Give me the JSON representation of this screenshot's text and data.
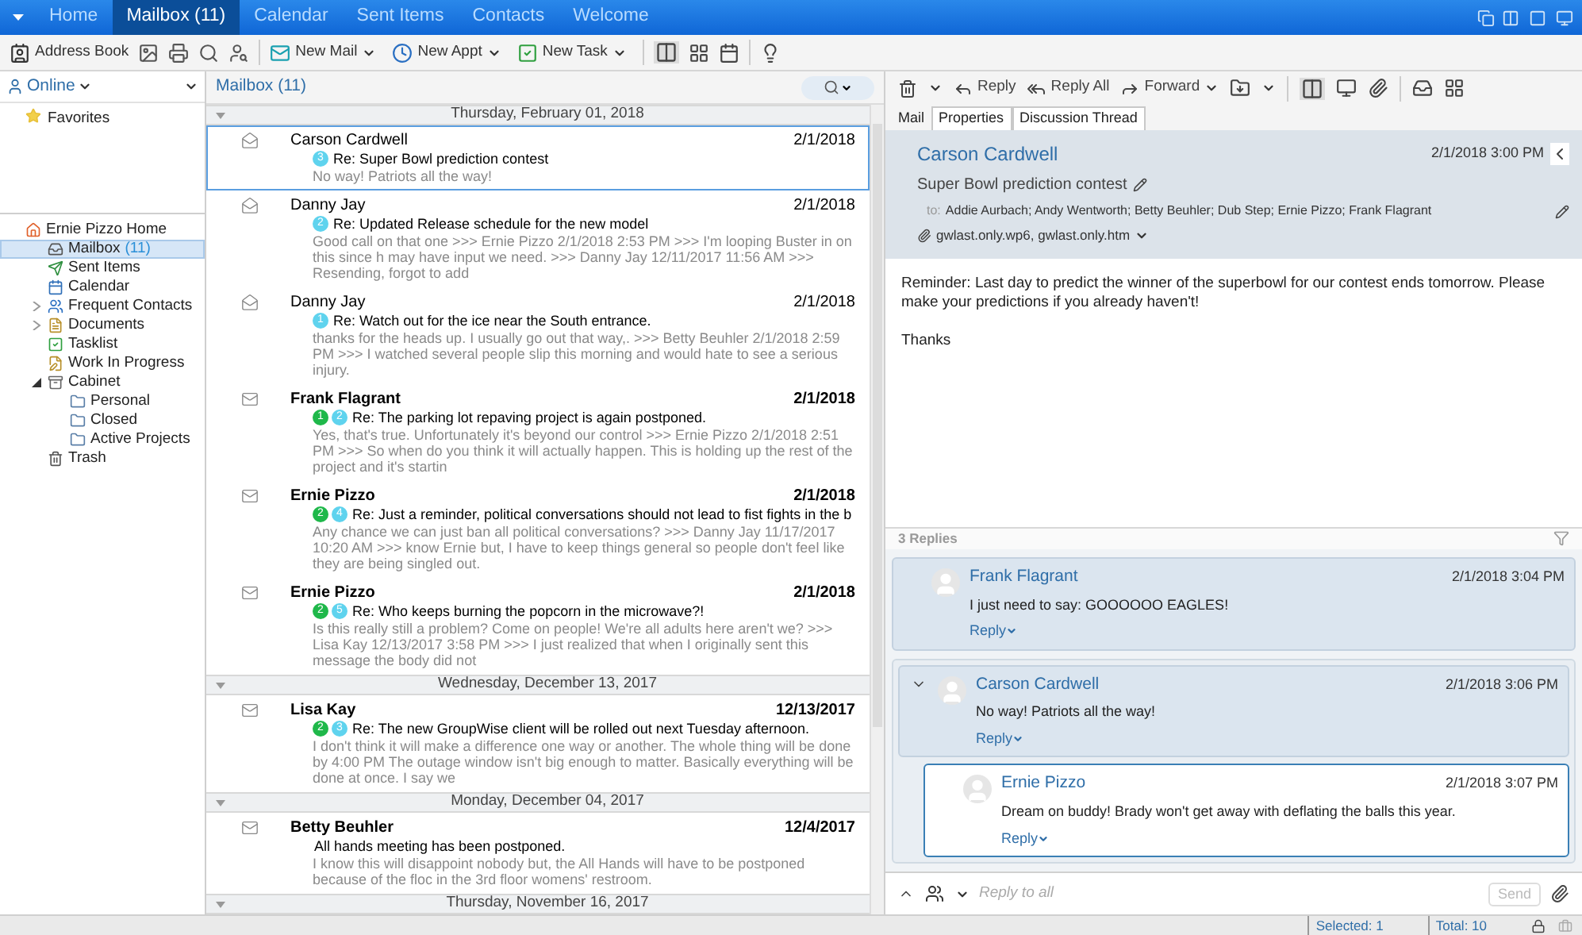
{
  "top_tabs": [
    {
      "label": "Home",
      "selected": false
    },
    {
      "label": "Mailbox (11)",
      "selected": true
    },
    {
      "label": "Calendar",
      "selected": false
    },
    {
      "label": "Sent Items",
      "selected": false
    },
    {
      "label": "Contacts",
      "selected": false
    },
    {
      "label": "Welcome",
      "selected": false
    }
  ],
  "toolbar": [
    {
      "label": "Address Book",
      "dropdown": false
    },
    {
      "label": "New Mail",
      "dropdown": true
    },
    {
      "label": "New Appt",
      "dropdown": true
    },
    {
      "label": "New Task",
      "dropdown": true
    }
  ],
  "sidebar": {
    "status": "Online",
    "favorites": "Favorites",
    "tree": [
      {
        "label": "Ernie Pizzo Home",
        "kind": "home",
        "selected": false,
        "children": [
          {
            "label": "Mailbox",
            "count": "(11)",
            "kind": "mailbox",
            "selected": true
          },
          {
            "label": "Sent Items",
            "kind": "sent",
            "selected": false
          },
          {
            "label": "Calendar",
            "kind": "calendar",
            "selected": false
          },
          {
            "label": "Frequent Contacts",
            "kind": "contacts",
            "selected": false,
            "expanded": false
          },
          {
            "label": "Documents",
            "kind": "documents",
            "selected": false,
            "expanded": false
          },
          {
            "label": "Tasklist",
            "kind": "tasklist",
            "selected": false
          },
          {
            "label": "Work In Progress",
            "kind": "work",
            "selected": false
          },
          {
            "label": "Cabinet",
            "kind": "cabinet",
            "selected": false,
            "expanded": true,
            "children": [
              {
                "label": "Personal",
                "kind": "folder",
                "selected": false
              },
              {
                "label": "Closed",
                "kind": "folder",
                "selected": false
              },
              {
                "label": "Active Projects",
                "kind": "folder",
                "selected": false
              }
            ]
          },
          {
            "label": "Trash",
            "kind": "trash",
            "selected": false
          }
        ]
      }
    ]
  },
  "message_list": {
    "title": "Mailbox (11)",
    "groups": [
      {
        "label": "Thursday, February 01, 2018",
        "expanded": true,
        "messages": [
          {
            "sender": "Carson Cardwell",
            "date": "2/1/2018",
            "read": true,
            "selected": true,
            "badges": [
              {
                "text": "3",
                "color": "#5fd3ee"
              }
            ],
            "subject": "Re: Super Bowl prediction contest",
            "preview": "No way! Patriots all the way!"
          },
          {
            "sender": "Danny Jay",
            "date": "2/1/2018",
            "read": true,
            "selected": false,
            "badges": [
              {
                "text": "2",
                "color": "#5fd3ee"
              }
            ],
            "subject": "Re: Updated Release schedule for the new model",
            "preview": "Good call on that one >>> Ernie Pizzo 2/1/2018 2:53 PM >>> I'm looping Buster in on this since h may have input we need. >>> Danny Jay 12/11/2017 11:56 AM >>> Resending, forgot to add"
          },
          {
            "sender": "Danny Jay",
            "date": "2/1/2018",
            "read": true,
            "selected": false,
            "badges": [
              {
                "text": "1",
                "color": "#5fd3ee"
              }
            ],
            "subject": "Re: Watch out for the ice near the South entrance.",
            "preview": "thanks for the heads up. I usually go out that way,. >>> Betty Beuhler 2/1/2018 2:59 PM >>> I watched several people slip this morning and would hate to see a serious injury."
          },
          {
            "sender": "Frank Flagrant",
            "date": "2/1/2018",
            "read": false,
            "selected": false,
            "badges": [
              {
                "text": "1",
                "color": "#1fb84a"
              },
              {
                "text": "2",
                "color": "#5fd3ee"
              }
            ],
            "subject": "Re: The parking lot repaving project is again postponed.",
            "preview": "Yes, that's true. Unfortunately it's beyond our control >>> Ernie Pizzo 2/1/2018 2:51 PM >>> So when do you think it will actually happen. This is holding up the rest of the project and it's startin"
          },
          {
            "sender": "Ernie Pizzo",
            "date": "2/1/2018",
            "read": false,
            "selected": false,
            "badges": [
              {
                "text": "2",
                "color": "#1fb84a"
              },
              {
                "text": "4",
                "color": "#5fd3ee"
              }
            ],
            "subject": "Re: Just a reminder, political conversations should not lead to fist fights in the b",
            "preview": "Any chance we can just ban all political conversations? >>> Danny Jay 11/17/2017 10:20 AM >>> know Ernie but, I have to keep things general so people don't feel like they are being singled out."
          },
          {
            "sender": "Ernie Pizzo",
            "date": "2/1/2018",
            "read": false,
            "selected": false,
            "badges": [
              {
                "text": "2",
                "color": "#1fb84a"
              },
              {
                "text": "5",
                "color": "#5fd3ee"
              }
            ],
            "subject": "Re: Who keeps burning the popcorn in the microwave?!",
            "preview": "Is this really still a problem? Come on people! We're all adults here aren't we? >>> Lisa Kay 12/13/2017 3:58 PM >>> I just realized that when I originally sent this message the body did not"
          }
        ]
      },
      {
        "label": "Wednesday, December 13, 2017",
        "expanded": true,
        "messages": [
          {
            "sender": "Lisa Kay",
            "date": "12/13/2017",
            "read": false,
            "selected": false,
            "badges": [
              {
                "text": "2",
                "color": "#1fb84a"
              },
              {
                "text": "3",
                "color": "#5fd3ee"
              }
            ],
            "subject": "Re: The new GroupWise client will be rolled out next Tuesday afternoon.",
            "preview": "I don't think it will make a difference one way or another. The whole thing will be done by 4:00 PM The outage window isn't big enough to matter. Basically everything will be done at once. I say we"
          }
        ]
      },
      {
        "label": "Monday, December 04, 2017",
        "expanded": true,
        "messages": [
          {
            "sender": "Betty Beuhler",
            "date": "12/4/2017",
            "read": false,
            "selected": false,
            "subject": "All hands meeting has been postponed.",
            "preview": "I know this will disappoint nobody but, the All Hands will have to be postponed because of the floc in the 3rd floor womens' restroom."
          }
        ]
      },
      {
        "label": "Thursday, November 16, 2017",
        "expanded": true
      }
    ]
  },
  "reading_pane": {
    "toolbar": [
      {
        "label": "Reply",
        "dropdown": false
      },
      {
        "label": "Reply All",
        "dropdown": false
      },
      {
        "label": "Forward",
        "dropdown": true
      }
    ],
    "tabs": [
      {
        "label": "Mail",
        "selected": true
      },
      {
        "label": "Properties",
        "selected": false
      },
      {
        "label": "Discussion Thread",
        "selected": false
      }
    ],
    "message": {
      "sender": "Carson Cardwell",
      "date": "2/1/2018 3:00 PM",
      "subject": "Super Bowl prediction contest",
      "to_label": "to:",
      "to": "Addie Aurbach; Andy Wentworth; Betty Beuhler; Dub Step; Ernie Pizzo; Frank Flagrant",
      "attachments": "gwlast.only.wp6, gwlast.only.htm",
      "body": [
        "Reminder: Last day to predict the winner of the superbowl for our contest ends tomorrow. Please make your predictions if you already haven't!",
        "Thanks"
      ]
    },
    "replies": {
      "count_label": "3 Replies",
      "items": [
        {
          "sender": "Frank Flagrant",
          "date": "2/1/2018 3:04 PM",
          "text": "I just need to say:  GOOOOOO EAGLES!",
          "reply_label": "Reply",
          "selected": false
        },
        {
          "sender": "Carson Cardwell",
          "date": "2/1/2018 3:06 PM",
          "text": "No way! Patriots all the way!",
          "reply_label": "Reply",
          "selected": false,
          "expanded": true,
          "children": [
            {
              "sender": "Ernie Pizzo",
              "date": "2/1/2018 3:07 PM",
              "text": "Dream on buddy!  Brady won't get away with deflating the balls this year.",
              "reply_label": "Reply",
              "selected": true
            }
          ]
        }
      ]
    },
    "composer": {
      "placeholder": "Reply to all",
      "send_label": "Send",
      "send_disabled": true
    }
  },
  "status_bar": {
    "selected": "Selected: 1",
    "total": "Total: 10"
  }
}
